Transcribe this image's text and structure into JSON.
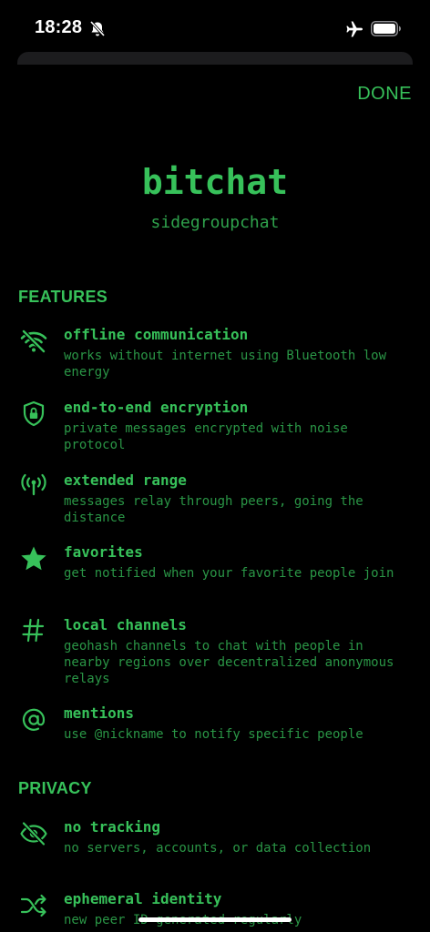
{
  "status_bar": {
    "time": "18:28",
    "icons": [
      "bell-slash-icon",
      "airplane-icon",
      "battery-icon"
    ]
  },
  "header": {
    "done_label": "DONE"
  },
  "app": {
    "title": "bitchat",
    "subtitle": "sidegroupchat"
  },
  "sections": {
    "features": {
      "header": "FEATURES",
      "items": [
        {
          "icon": "wifi-slash-icon",
          "title": "offline communication",
          "desc": "works without internet using Bluetooth low energy"
        },
        {
          "icon": "lock-shield-icon",
          "title": "end-to-end encryption",
          "desc": "private messages encrypted with noise protocol"
        },
        {
          "icon": "antenna-icon",
          "title": "extended range",
          "desc": "messages relay through peers, going the distance"
        },
        {
          "icon": "star-icon",
          "title": "favorites",
          "desc": "get notified when your favorite people join"
        },
        {
          "icon": "hash-icon",
          "title": "local channels",
          "desc": "geohash channels to chat with people in nearby regions over decentralized anonymous relays"
        },
        {
          "icon": "at-icon",
          "title": "mentions",
          "desc": "use @nickname to notify specific people"
        }
      ]
    },
    "privacy": {
      "header": "PRIVACY",
      "items": [
        {
          "icon": "eye-slash-icon",
          "title": "no tracking",
          "desc": "no servers, accounts, or data collection"
        },
        {
          "icon": "shuffle-icon",
          "title": "ephemeral identity",
          "desc": "new peer ID generated regularly"
        }
      ]
    }
  },
  "colors": {
    "accent": "#37c15a",
    "text_secondary": "#2a9646",
    "background": "#000000"
  }
}
